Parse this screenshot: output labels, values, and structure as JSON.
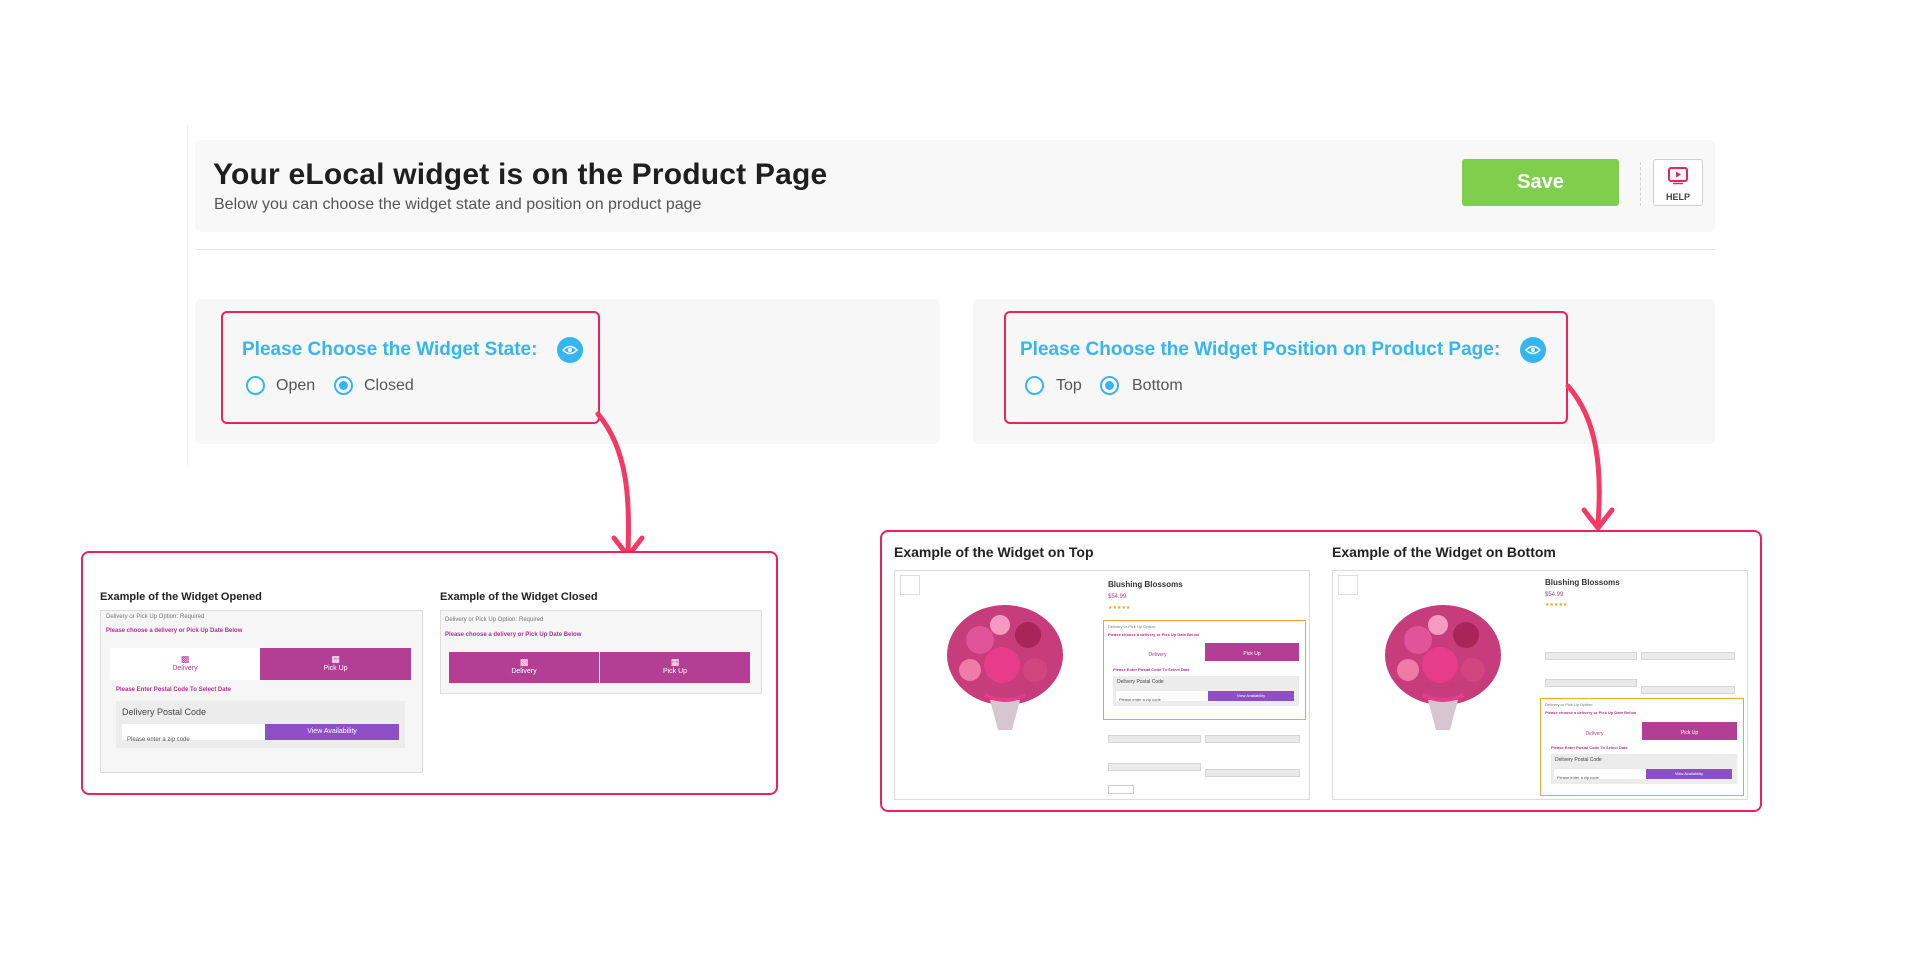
{
  "header": {
    "title": "Your eLocal widget is on the Product Page",
    "subtitle": "Below you can choose the widget state and position on product page",
    "save_label": "Save",
    "help_label": "HELP"
  },
  "state_card": {
    "title": "Please Choose the Widget State:",
    "options": [
      "Open",
      "Closed"
    ],
    "selected": "Closed"
  },
  "position_card": {
    "title": "Please Choose the Widget Position on Product Page:",
    "options": [
      "Top",
      "Bottom"
    ],
    "selected": "Bottom"
  },
  "examples_state": {
    "opened_title": "Example of the Widget Opened",
    "closed_title": "Example of the Widget Closed",
    "option_label": "Delivery or Pick Up Option:",
    "required": "Required",
    "choose_text": "Please choose a delivery or Pick Up Date Below",
    "delivery": "Delivery",
    "pickup": "Pick Up",
    "enter_postal": "Please Enter Postal Code To Select Date",
    "postal_label": "Delivery Postal Code",
    "zip_placeholder": "Please enter a zip code",
    "view_availability": "View Availability"
  },
  "examples_position": {
    "top_title": "Example of the Widget on Top",
    "bottom_title": "Example of the Widget on Bottom",
    "product_name": "Blushing Blossoms",
    "price": "$54.99",
    "option_label": "Delivery or Pick Up Option:",
    "required": "Required",
    "choose_text": "Please choose a delivery or Pick Up Date Below",
    "delivery": "Delivery",
    "pickup": "Pick Up",
    "enter_postal": "Please Enter Postal Code To Select Date",
    "postal_label": "Delivery Postal Code",
    "zip_placeholder": "Please enter a zip code",
    "view_availability": "View Availability"
  },
  "colors": {
    "accent_blue": "#35b6f0",
    "save_green": "#7fcf4c",
    "highlight_pink": "#e8245a",
    "widget_magenta": "#b23f93",
    "widget_purple": "#8e4fc4"
  }
}
